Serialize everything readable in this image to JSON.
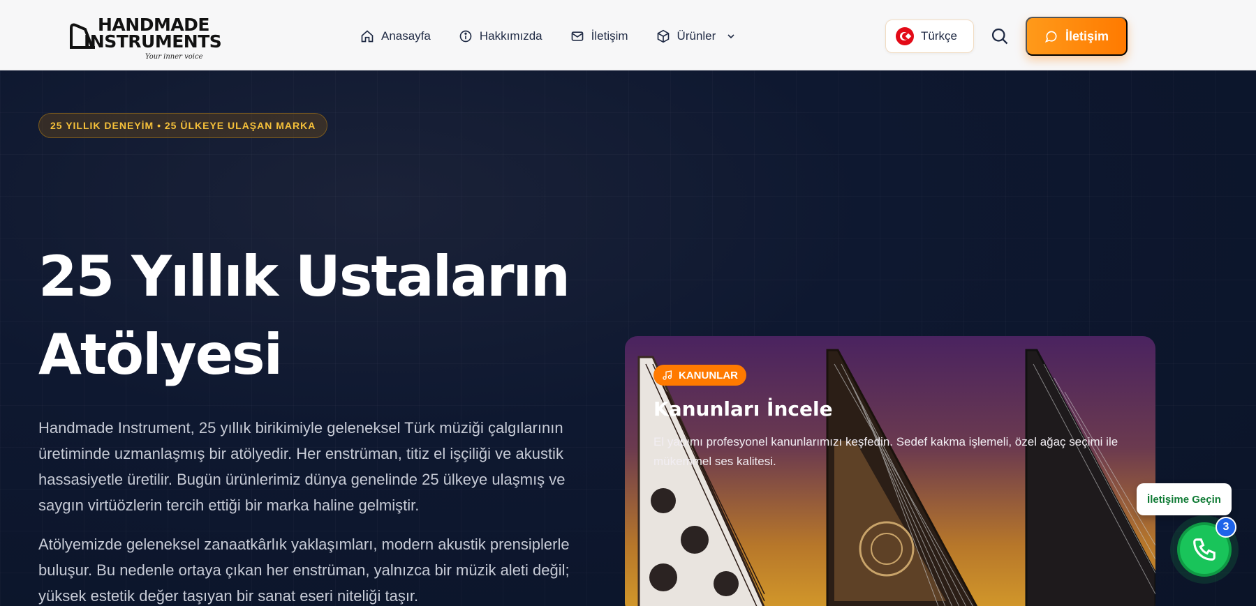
{
  "brand": {
    "name_line1": "HANDMADE",
    "name_line2": "INSTRUMENTS",
    "tagline": "Your inner voice"
  },
  "nav": {
    "items": [
      {
        "label": "Anasayfa",
        "icon": "home-icon"
      },
      {
        "label": "Hakkımızda",
        "icon": "info-icon"
      },
      {
        "label": "İletişim",
        "icon": "mail-icon"
      },
      {
        "label": "Ürünler",
        "icon": "box-icon",
        "has_dropdown": true
      }
    ]
  },
  "language": {
    "label": "Türkçe",
    "flag": "turkey-flag-icon"
  },
  "header_cta": {
    "label": "İletişim",
    "icon": "chat-bubble-icon",
    "color": "#ff8a00"
  },
  "hero": {
    "badge": "25 YILLIK DENEYİM • 25 ÜLKEYE ULAŞAN MARKA",
    "title_line1": "25 Yıllık Ustaların",
    "title_line2": "Atölyesi",
    "paragraph1": "Handmade Instrument, 25 yıllık birikimiyle geleneksel Türk müziği çalgılarının üretiminde uzmanlaşmış bir atölyedir. Her enstrüman, titiz el işçiliği ve akustik hassasiyetle üretilir. Bugün ürünlerimiz dünya genelinde 25 ülkeye ulaşmış ve saygın virtüözlerin tercih ettiği bir marka haline gelmiştir.",
    "paragraph2": "Atölyemizde geleneksel zanaatkârlık yaklaşımları, modern akustik prensiplerle buluşur. Bu nedenle ortaya çıkan her enstrüman, yalnızca bir müzik aleti değil; yüksek estetik değer taşıyan bir sanat eseri niteliği taşır."
  },
  "product_card": {
    "badge": "KANUNLAR",
    "badge_icon": "music-note-icon",
    "title": "Kanunları İncele",
    "description": "El yapımı profesyonel kanunlarımızı keşfedin. Sedef kakma işlemeli, özel ağaç seçimi ile mükemmel ses kalitesi."
  },
  "contact_widget": {
    "tooltip": "İletişime Geçin",
    "icon": "phone-icon",
    "count": "3",
    "color": "#19c45a"
  }
}
